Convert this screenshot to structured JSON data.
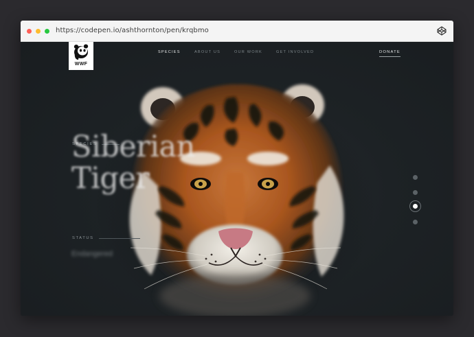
{
  "browser": {
    "url": "https://codepen.io/ashthornton/pen/krqbmo",
    "icon": "codepen-icon"
  },
  "nav": {
    "logo_text": "WWF",
    "items": [
      {
        "label": "SPECIES",
        "active": true
      },
      {
        "label": "ABOUT US",
        "active": false
      },
      {
        "label": "OUR WORK",
        "active": false
      },
      {
        "label": "GET INVOLVED",
        "active": false
      }
    ],
    "donate": "DONATE"
  },
  "hero": {
    "species_label": "SPECIES",
    "species_name_line1": "Siberian",
    "species_name_line2": "Tiger",
    "status_label": "STATUS",
    "status_value": "Endangered"
  },
  "pager": {
    "count": 4,
    "active_index": 2
  },
  "colors": {
    "background": "#1c2124",
    "accent": "#ffffff",
    "tiger_orange": "#c46a2a"
  }
}
